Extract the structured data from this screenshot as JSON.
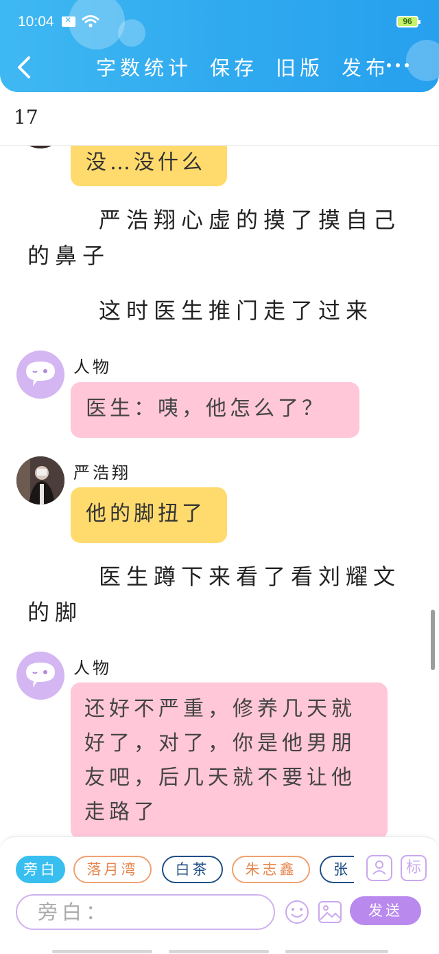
{
  "status_bar": {
    "time": "10:04",
    "battery": "96"
  },
  "header": {
    "actions": [
      "字数统计",
      "保存",
      "旧版",
      "发布"
    ],
    "more": "•••"
  },
  "counter": "17",
  "messages": {
    "m1": {
      "text": "没…没什么"
    },
    "n1": {
      "text": "严浩翔心虚的摸了摸自己的鼻子"
    },
    "n2": {
      "text": "这时医生推门走了过来"
    },
    "m2": {
      "speaker": "人物",
      "text": "医生：咦，他怎么了？"
    },
    "m3": {
      "speaker": "严浩翔",
      "text": "他的脚扭了"
    },
    "n3": {
      "text": "医生蹲下来看了看刘耀文的脚"
    },
    "m4": {
      "speaker": "人物",
      "text": "还好不严重，修养几天就好了，对了，你是他男朋友吧，后几天就不要让他走路了"
    }
  },
  "composer": {
    "chips": [
      "旁白",
      "落月湾",
      "白茶",
      "朱志鑫",
      "张"
    ],
    "role_button": "person-icon",
    "tag_button": "标",
    "input_placeholder": "旁白：",
    "send": "发送"
  },
  "colors": {
    "header": "#2fa9ef",
    "yellow_bubble": "#ffdb6e",
    "pink_bubble": "#ffc7d8",
    "purple_avatar": "#d4b6f2",
    "send_button": "#b989ee",
    "active_chip": "#38bff0"
  }
}
